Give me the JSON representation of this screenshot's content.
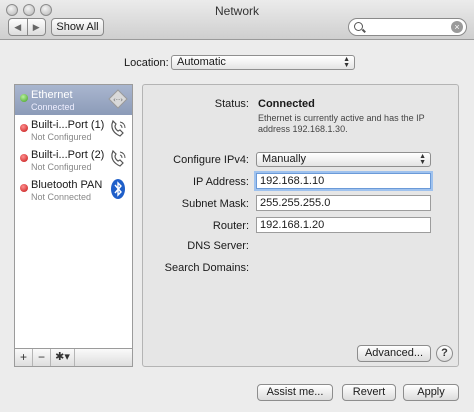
{
  "window": {
    "title": "Network",
    "show_all": "Show All",
    "nav_back": "◀",
    "nav_forward": "▶",
    "search_placeholder": ""
  },
  "location": {
    "label": "Location:",
    "value": "Automatic"
  },
  "sidebar": {
    "services": [
      {
        "name": "Ethernet",
        "status": "Connected",
        "indicator": "green",
        "icon": "ethernet-icon",
        "selected": true
      },
      {
        "name": "Built-i...Port (1)",
        "status": "Not Configured",
        "indicator": "red",
        "icon": "phone-modem-icon"
      },
      {
        "name": "Built-i...Port (2)",
        "status": "Not Configured",
        "indicator": "red",
        "icon": "phone-modem-icon"
      },
      {
        "name": "Bluetooth PAN",
        "status": "Not Connected",
        "indicator": "red",
        "icon": "bluetooth-icon"
      }
    ],
    "add": "+",
    "remove": "−",
    "action": "✱▾"
  },
  "detail": {
    "status_label": "Status:",
    "status_value": "Connected",
    "status_desc_line1": "Ethernet is currently active and has the IP",
    "status_desc_line2": "address 192.168.1.30.",
    "configure_label": "Configure IPv4:",
    "configure_value": "Manually",
    "ip_label": "IP Address:",
    "ip_value": "192.168.1.10",
    "subnet_label": "Subnet Mask:",
    "subnet_value": "255.255.255.0",
    "router_label": "Router:",
    "router_value": "192.168.1.20",
    "dns_label": "DNS Server:",
    "search_domains_label": "Search Domains:",
    "advanced": "Advanced...",
    "help": "?"
  },
  "footer": {
    "assist": "Assist me...",
    "revert": "Revert",
    "apply": "Apply"
  },
  "colors": {
    "connected": "#3e9d1f",
    "not_connected": "#c21313",
    "selection": "#8c9bb8",
    "focus": "#6b9ad8"
  }
}
